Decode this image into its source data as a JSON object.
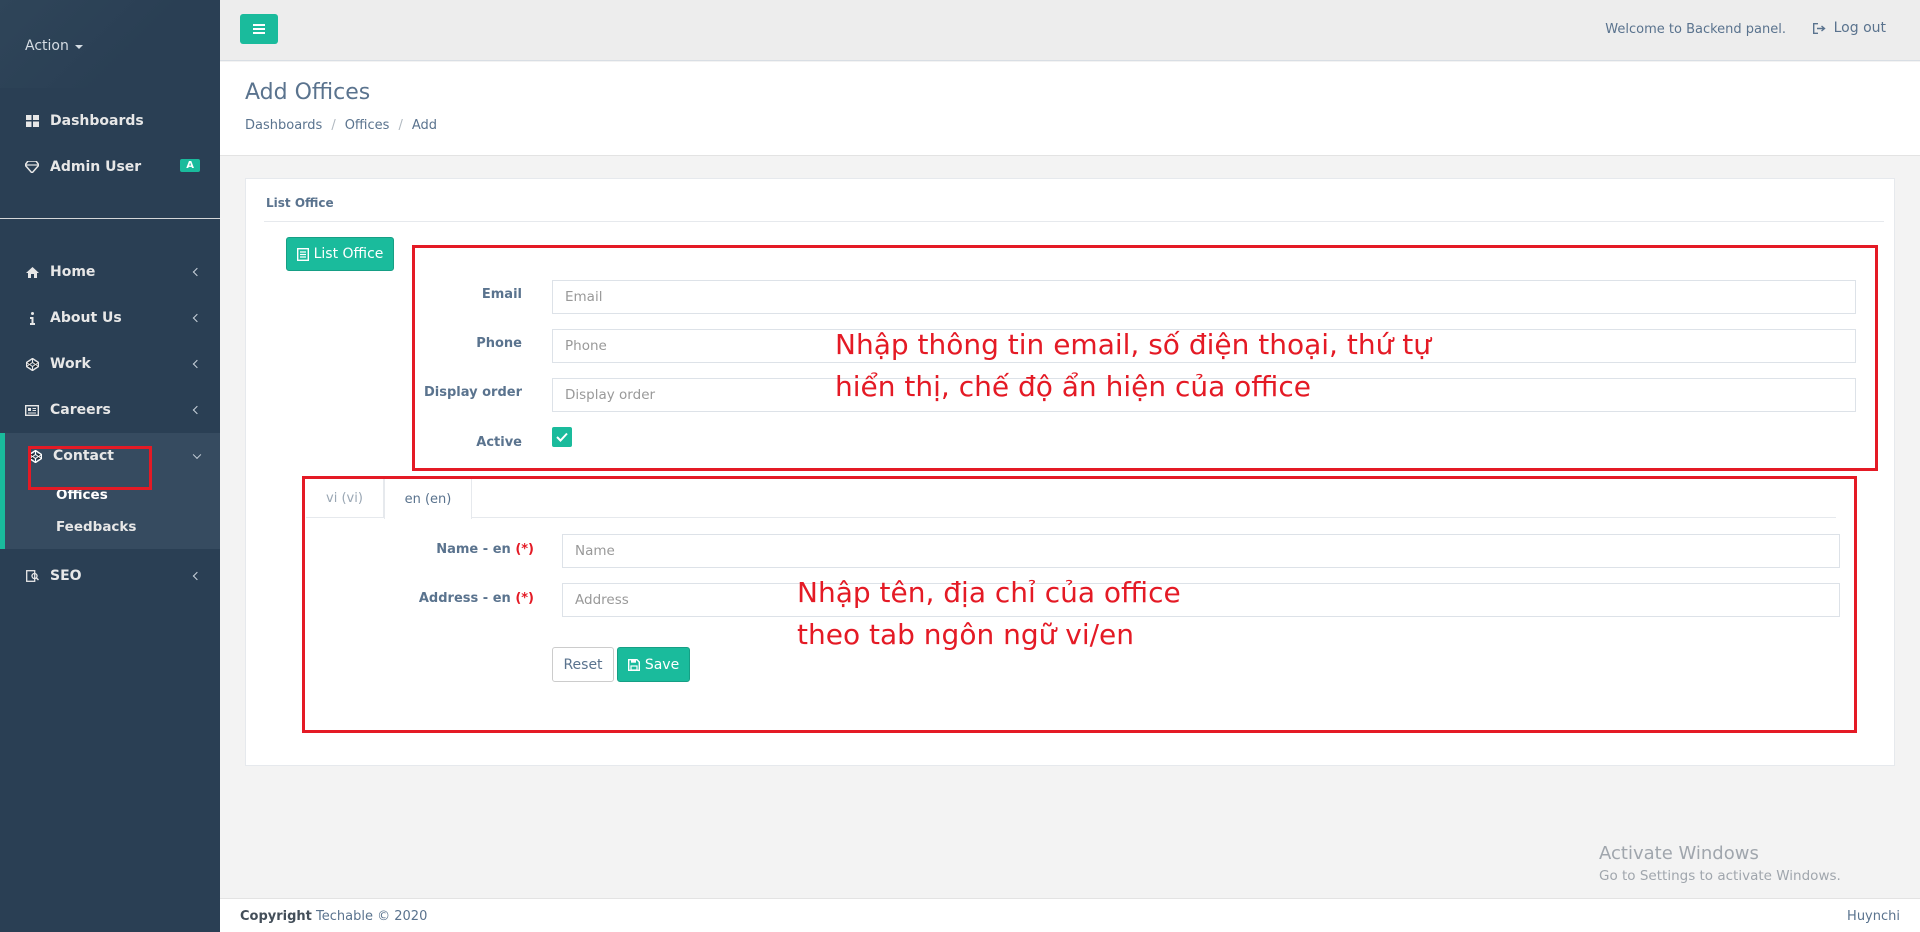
{
  "sidebar": {
    "action_label": "Action",
    "top_items": [
      {
        "label": "Dashboards",
        "icon": "dashboard-icon"
      },
      {
        "label": "Admin User",
        "icon": "diamond-icon",
        "badge": "A"
      }
    ],
    "items": [
      {
        "label": "Home",
        "icon": "home-icon"
      },
      {
        "label": "About Us",
        "icon": "info-icon"
      },
      {
        "label": "Work",
        "icon": "codepen-icon"
      },
      {
        "label": "Careers",
        "icon": "newspaper-icon"
      }
    ],
    "contact": {
      "label": "Contact",
      "icon": "codepen-icon",
      "children": [
        "Offices",
        "Feedbacks"
      ]
    },
    "seo": {
      "label": "SEO",
      "icon": "seo-icon"
    }
  },
  "topnav": {
    "welcome": "Welcome to Backend panel.",
    "logout": "Log out"
  },
  "page": {
    "title": "Add Offices",
    "breadcrumb": [
      "Dashboards",
      "Offices",
      "Add"
    ]
  },
  "panel": {
    "title": "List Office",
    "list_button": "List Office"
  },
  "form": {
    "email_label": "Email",
    "email_placeholder": "Email",
    "phone_label": "Phone",
    "phone_placeholder": "Phone",
    "order_label": "Display order",
    "order_placeholder": "Display order",
    "active_label": "Active",
    "active_checked": true
  },
  "lang_tabs": [
    "vi (vi)",
    "en (en)"
  ],
  "lang_form": {
    "name_label": "Name - en",
    "name_placeholder": "Name",
    "address_label": "Address - en",
    "address_placeholder": "Address",
    "required_mark": "(*)",
    "reset": "Reset",
    "save": "Save"
  },
  "annotations": {
    "first": [
      "Nhập thông tin email, số điện thoại, thứ tự",
      "hiển thị, chế độ ẩn hiện của office"
    ],
    "second": [
      "Nhập tên, địa chỉ của office",
      "theo tab ngôn ngữ vi/en"
    ]
  },
  "watermark": {
    "line1": "Activate Windows",
    "line2": "Go to Settings to activate Windows."
  },
  "footer": {
    "copyright_label": "Copyright",
    "copyright_text": "Techable © 2020",
    "right": "Huynchi"
  },
  "colors": {
    "sidebar": "#2a3f54",
    "accent": "#1abb9c",
    "annotation": "#e41a25"
  }
}
